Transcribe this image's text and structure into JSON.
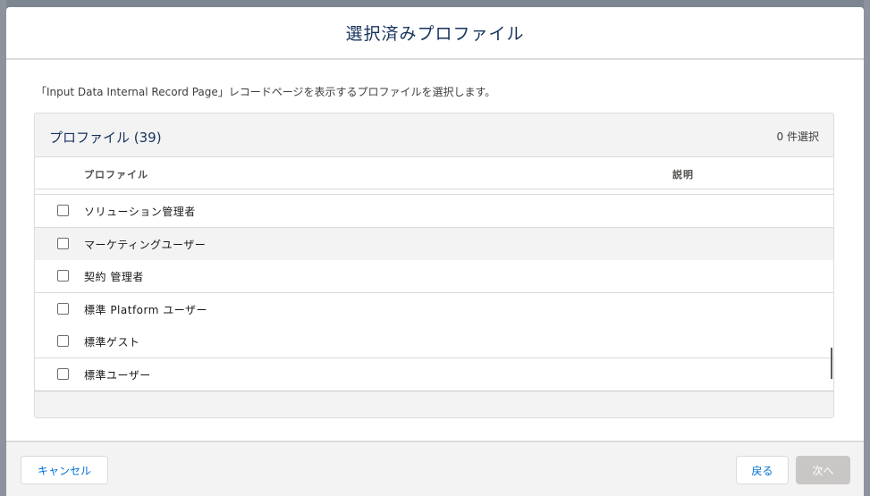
{
  "modal": {
    "title": "選択済みプロファイル",
    "instruction": "「Input Data Internal Record Page」レコードページを表示するプロファイルを選択します。"
  },
  "list": {
    "title": "プロファイル (39)",
    "selected_count": "0 件選択",
    "columns": {
      "profile": "プロファイル",
      "description": "説明"
    },
    "rows": [
      {
        "label": "ソリューション管理者",
        "checked": false
      },
      {
        "label": "マーケティングユーザー",
        "checked": false
      },
      {
        "label": "契約 管理者",
        "checked": false
      },
      {
        "label": "標準 Platform ユーザー",
        "checked": false
      },
      {
        "label": "標準ゲスト",
        "checked": false
      },
      {
        "label": "標準ユーザー",
        "checked": false
      }
    ]
  },
  "footer": {
    "cancel_label": "キャンセル",
    "back_label": "戻る",
    "next_label": "次へ"
  },
  "colors": {
    "title": "#16325c",
    "link": "#0070d2",
    "disabled_button": "#c9c7c5",
    "backdrop": "#7d8591"
  }
}
